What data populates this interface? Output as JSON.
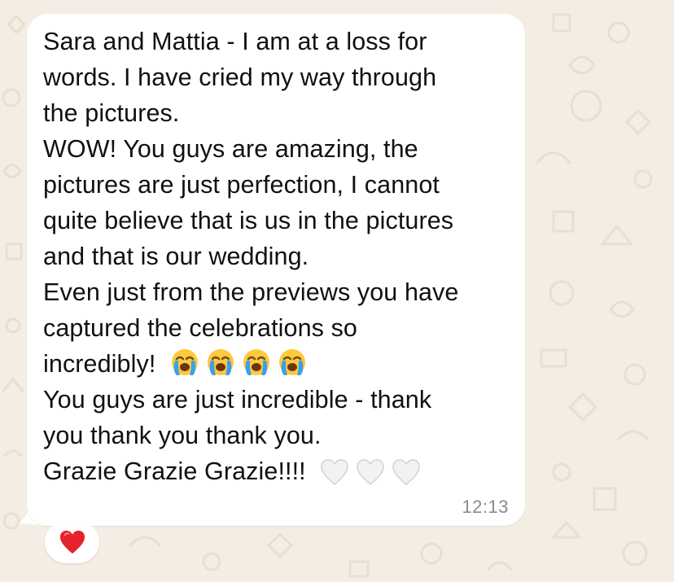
{
  "message": {
    "lines": {
      "l1": "Sara and Mattia - I am at a loss for",
      "l2": "words. I have cried my way through",
      "l3": "the pictures.",
      "l4": "WOW! You guys are amazing, the",
      "l5": "pictures are just perfection, I cannot",
      "l6": "quite believe that is us in the pictures",
      "l7": "and that is our wedding.",
      "l8": "Even just from the previews you have",
      "l9": "captured the celebrations so",
      "l10": "incredibly!",
      "l11": "You guys are just incredible - thank",
      "l12": "you thank you thank you.",
      "l13": "Grazie Grazie Grazie!!!!"
    },
    "emojis_after_l10": [
      "loudly-crying-face-icon",
      "loudly-crying-face-icon",
      "loudly-crying-face-icon",
      "loudly-crying-face-icon"
    ],
    "emojis_after_l13": [
      "white-heart-icon",
      "white-heart-icon",
      "white-heart-icon"
    ],
    "timestamp": "12:13"
  },
  "reaction": {
    "icon": "red-heart-icon"
  },
  "colors": {
    "wallpaper": "#f3ede3",
    "bubble": "#ffffff",
    "text": "#111111",
    "timestamp": "#8b8b8b",
    "reaction_heart": "#e8222c"
  }
}
